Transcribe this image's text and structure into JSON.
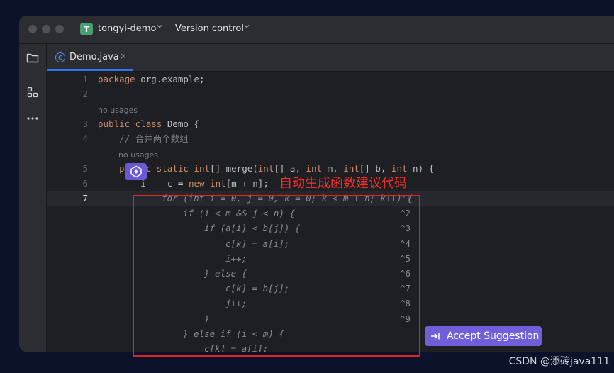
{
  "titlebar": {
    "project_badge": "T",
    "project_name": "tongyi-demo",
    "vcs_label": "Version control"
  },
  "tab": {
    "file_icon": "C",
    "label": "Demo.java",
    "close": "×"
  },
  "editor": {
    "inlay_usages": "no usages",
    "lines": [
      {
        "num": "1",
        "parts": [
          [
            "kw",
            "package"
          ],
          [
            "",
            " org.example;"
          ]
        ]
      },
      {
        "num": "2",
        "parts": []
      },
      {
        "num": "3",
        "parts": [
          [
            "kw",
            "public class"
          ],
          [
            "",
            " Demo {"
          ]
        ]
      },
      {
        "num": "4",
        "parts": [
          [
            "cm",
            "    // 合并两个数组"
          ]
        ]
      },
      {
        "num": "5",
        "parts": [
          [
            "",
            "    "
          ],
          [
            "kw",
            "public static int"
          ],
          [
            "",
            "[] merge("
          ],
          [
            "kw",
            "int"
          ],
          [
            "",
            "[] a, "
          ],
          [
            "kw",
            "int"
          ],
          [
            "",
            " m, "
          ],
          [
            "kw",
            "int"
          ],
          [
            "",
            "[] b, "
          ],
          [
            "kw",
            "int"
          ],
          [
            "",
            " n) {"
          ]
        ]
      },
      {
        "num": "6",
        "parts": [
          [
            "",
            "        i"
          ],
          [
            "",
            "    c = "
          ],
          [
            "kw",
            "new int"
          ],
          [
            "",
            "[m + n];"
          ]
        ]
      },
      {
        "num": "7",
        "parts": []
      }
    ],
    "ghost_lines": [
      {
        "indent": 0,
        "text": "for (int i = 0, j = 0, k = 0; k < m + n; k++) {",
        "hint": "^1"
      },
      {
        "indent": 1,
        "text": "if (i < m && j < n) {",
        "hint": "^2"
      },
      {
        "indent": 2,
        "text": "if (a[i] < b[j]) {",
        "hint": "^3"
      },
      {
        "indent": 3,
        "text": "c[k] = a[i];",
        "hint": "^4"
      },
      {
        "indent": 3,
        "text": "i++;",
        "hint": "^5"
      },
      {
        "indent": 2,
        "text": "} else {",
        "hint": "^6"
      },
      {
        "indent": 3,
        "text": "c[k] = b[j];",
        "hint": "^7"
      },
      {
        "indent": 3,
        "text": "j++;",
        "hint": "^8"
      },
      {
        "indent": 2,
        "text": "}",
        "hint": "^9"
      },
      {
        "indent": 1,
        "text": "} else if (i < m) {",
        "hint": ""
      },
      {
        "indent": 2,
        "text": "c[k] = a[i];",
        "hint": ""
      }
    ]
  },
  "annotation": "自动生成函数建议代码",
  "accept_button": "Accept Suggestion",
  "watermark": "CSDN @添砖java111",
  "colors": {
    "accent": "#3574f0",
    "ai_purple": "#6f5fd8",
    "annotation_red": "#e02424"
  },
  "icons": [
    "folder-icon",
    "structure-icon",
    "more-icon",
    "java-class-icon",
    "close-icon",
    "chevron-down-icon",
    "tongyi-ai-icon",
    "accept-tab-icon"
  ]
}
